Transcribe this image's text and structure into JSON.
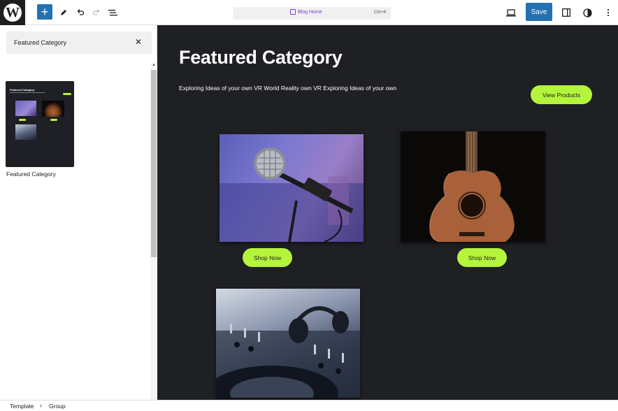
{
  "toolbar": {
    "document_title": "Blog Home",
    "shortcut": "Ctrl+K",
    "save_label": "Save"
  },
  "sidebar": {
    "search_value": "Featured Category",
    "pattern_label": "Featured Category",
    "thumb_title": "Featured Category"
  },
  "breadcrumb": {
    "items": [
      "Template",
      "Group"
    ]
  },
  "canvas": {
    "title": "Featured Category",
    "subtitle": "Exploring Ideas of your own VR World Reality own VR Exploring Ideas of your own",
    "view_products_label": "View Products",
    "shop_now_label": "Shop Now",
    "shop_now_label_2": "Shop Now"
  },
  "colors": {
    "accent": "#b4f53c",
    "canvas_bg": "#1f2024",
    "primary": "#2271b1"
  },
  "icons": [
    "wordpress-logo-icon",
    "plus-icon",
    "pencil-icon",
    "undo-icon",
    "redo-icon",
    "list-view-icon",
    "template-icon",
    "desktop-view-icon",
    "sidebar-toggle-icon",
    "contrast-icon",
    "more-options-icon",
    "close-icon",
    "chevron-right-icon"
  ]
}
